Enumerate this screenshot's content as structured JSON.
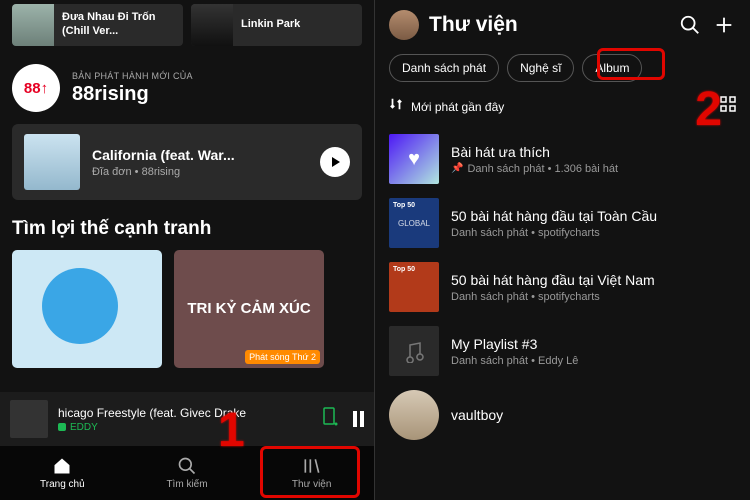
{
  "left": {
    "top_cards": [
      {
        "title": "Đưa Nhau Đi Trốn (Chill Ver..."
      },
      {
        "title": "Linkin Park"
      }
    ],
    "artist": {
      "sub": "BẢN PHÁT HÀNH MỚI CỦA",
      "name": "88rising",
      "avatar_text": "88↑"
    },
    "release": {
      "title": "California (feat. War...",
      "sub": "Đĩa đơn • 88rising"
    },
    "section_title": "Tìm lợi thế cạnh tranh",
    "card2_overlay": "TRI KỶ CẢM XÚC",
    "card2_badge": "Phát sóng Thứ 2",
    "now_playing": {
      "title": "hicago Freestyle (feat. Givec   Drake",
      "artist": "EDDY"
    },
    "nav": {
      "home": "Trang chủ",
      "search": "Tìm kiếm",
      "library": "Thư viện"
    }
  },
  "right": {
    "title": "Thư viện",
    "chips": [
      "Danh sách phát",
      "Nghệ sĩ",
      "Album"
    ],
    "sort_label": "Mới phát gần đây",
    "items": [
      {
        "name": "Bài hát ưa thích",
        "sub": "Danh sách phát • 1.306 bài hát",
        "pinned": true
      },
      {
        "name": "50 bài hát hàng đầu tại Toàn Cầu",
        "sub": "Danh sách phát • spotifycharts"
      },
      {
        "name": "50 bài hát hàng đầu tại Việt Nam",
        "sub": "Danh sách phát • spotifycharts"
      },
      {
        "name": "My Playlist #3",
        "sub": "Danh sách phát • Eddy Lê"
      },
      {
        "name": "vaultboy",
        "sub": ""
      }
    ],
    "top50_badge": "Top 50",
    "global_text": "GLOBAL"
  },
  "annotations": {
    "num1": "1",
    "num2": "2"
  }
}
